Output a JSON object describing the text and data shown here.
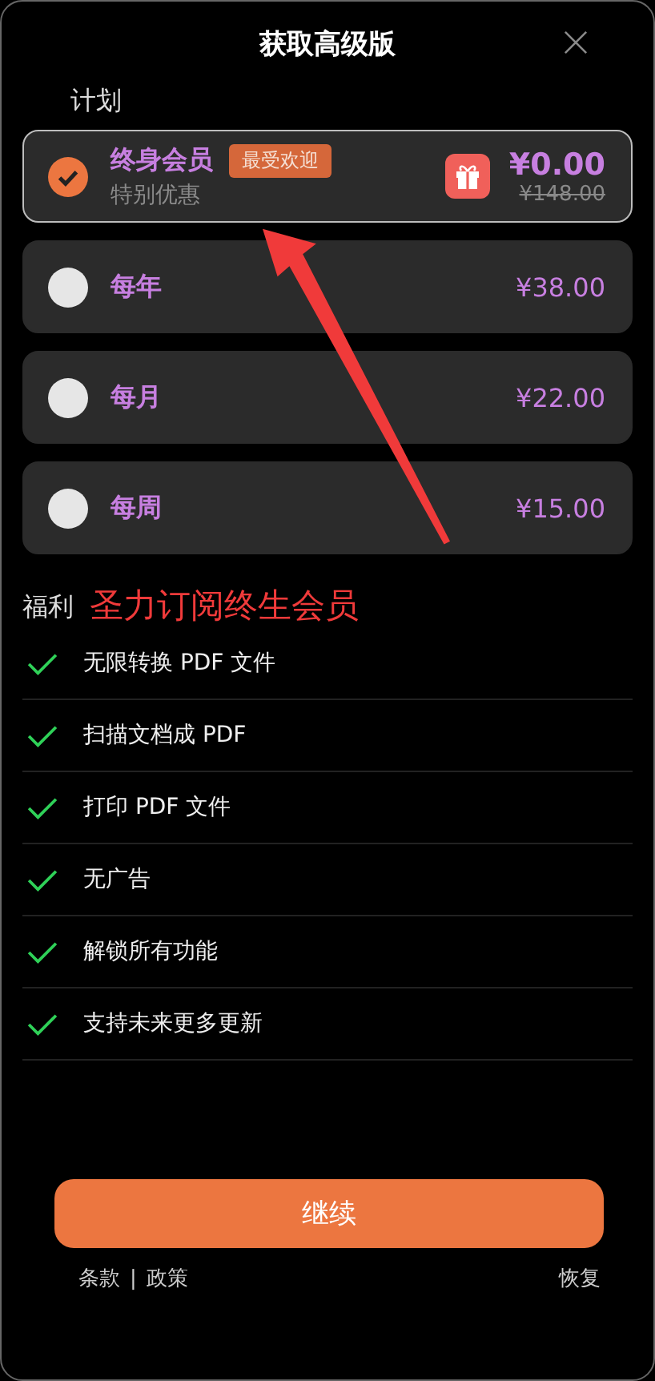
{
  "header": {
    "title": "获取高级版"
  },
  "plans_section": {
    "title": "计划"
  },
  "plans": [
    {
      "name": "终身会员",
      "badge": "最受欢迎",
      "subtitle": "特别优惠",
      "price": "¥0.00",
      "original_price": "¥148.00",
      "gift": true,
      "selected": true
    },
    {
      "name": "每年",
      "price": "¥38.00",
      "selected": false
    },
    {
      "name": "每月",
      "price": "¥22.00",
      "selected": false
    },
    {
      "name": "每周",
      "price": "¥15.00",
      "selected": false
    }
  ],
  "benefits_section": {
    "title": "福利",
    "annotation": "圣力订阅终生会员"
  },
  "benefits": [
    "无限转换 PDF 文件",
    "扫描文档成 PDF",
    "打印 PDF 文件",
    "无广告",
    "解锁所有功能",
    "支持未来更多更新"
  ],
  "continue_button": "继续",
  "footer": {
    "terms": "条款",
    "separator": "|",
    "policy": "政策",
    "restore": "恢复"
  }
}
